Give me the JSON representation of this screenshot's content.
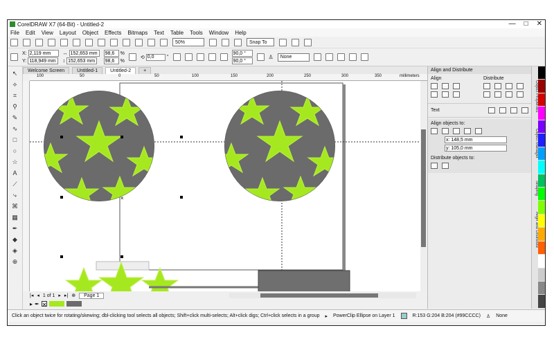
{
  "app": {
    "title": "CorelDRAW X7 (64-Bit) - Untitled-2",
    "win_min": "—",
    "win_max": "□",
    "win_close": "✕"
  },
  "menu": [
    "File",
    "Edit",
    "View",
    "Layout",
    "Object",
    "Effects",
    "Bitmaps",
    "Text",
    "Table",
    "Tools",
    "Window",
    "Help"
  ],
  "toolbar": {
    "zoom": "50%",
    "snap": "Snap To"
  },
  "props": {
    "x": "2,119 mm",
    "y": "118,949 mm",
    "w": "152,653 mm",
    "h": "152,653 mm",
    "sx": "98,6",
    "sy": "98,6",
    "pct": "%",
    "angle": "0,0",
    "deg": "°",
    "arc1": "90,0 °",
    "arc2": "90,0 °",
    "outline": "None"
  },
  "tabs": [
    "Welcome Screen",
    "Untitled-1",
    "Untitled-2"
  ],
  "ruler_labels": [
    "100",
    "50",
    "0",
    "50",
    "100",
    "150",
    "200",
    "250",
    "300",
    "350"
  ],
  "ruler_unit": "millimeters",
  "page_nav": {
    "count": "1 of 1",
    "page": "Page 1"
  },
  "status": {
    "hint": "Click an object twice for rotating/skewing; dbl-clicking tool selects all objects; Shift+click multi-selects; Alt+click digs; Ctrl+click selects in a group",
    "object": "PowerClip Ellipse on Layer 1",
    "fill": "R:153 G:204 B:204 (#99CCCC)",
    "outline": "None"
  },
  "docker": {
    "title": "Align and Distribute",
    "align": "Align",
    "distribute": "Distribute",
    "text": "Text",
    "align_to": "Align objects to:",
    "x_field": "x: 148,5 mm",
    "y_field": "y: 105,0 mm",
    "dist_to": "Distribute objects to:"
  },
  "side_tabs": [
    "Object Properties",
    "Object Manager",
    "Shaping",
    "Align and Distribute"
  ],
  "colors": {
    "star": "#a6e81f",
    "ball": "#6b6b6b",
    "grey_rect": "#6f6f6f",
    "palette": [
      "#000000",
      "#9a0000",
      "#d40000",
      "#ff00ff",
      "#7a00ff",
      "#2020ff",
      "#00a0ff",
      "#00ffff",
      "#00c060",
      "#00ff00",
      "#7fff00",
      "#ffff00",
      "#ffaa00",
      "#ff6000",
      "#ffffff",
      "#cccccc",
      "#888888",
      "#444444"
    ]
  }
}
